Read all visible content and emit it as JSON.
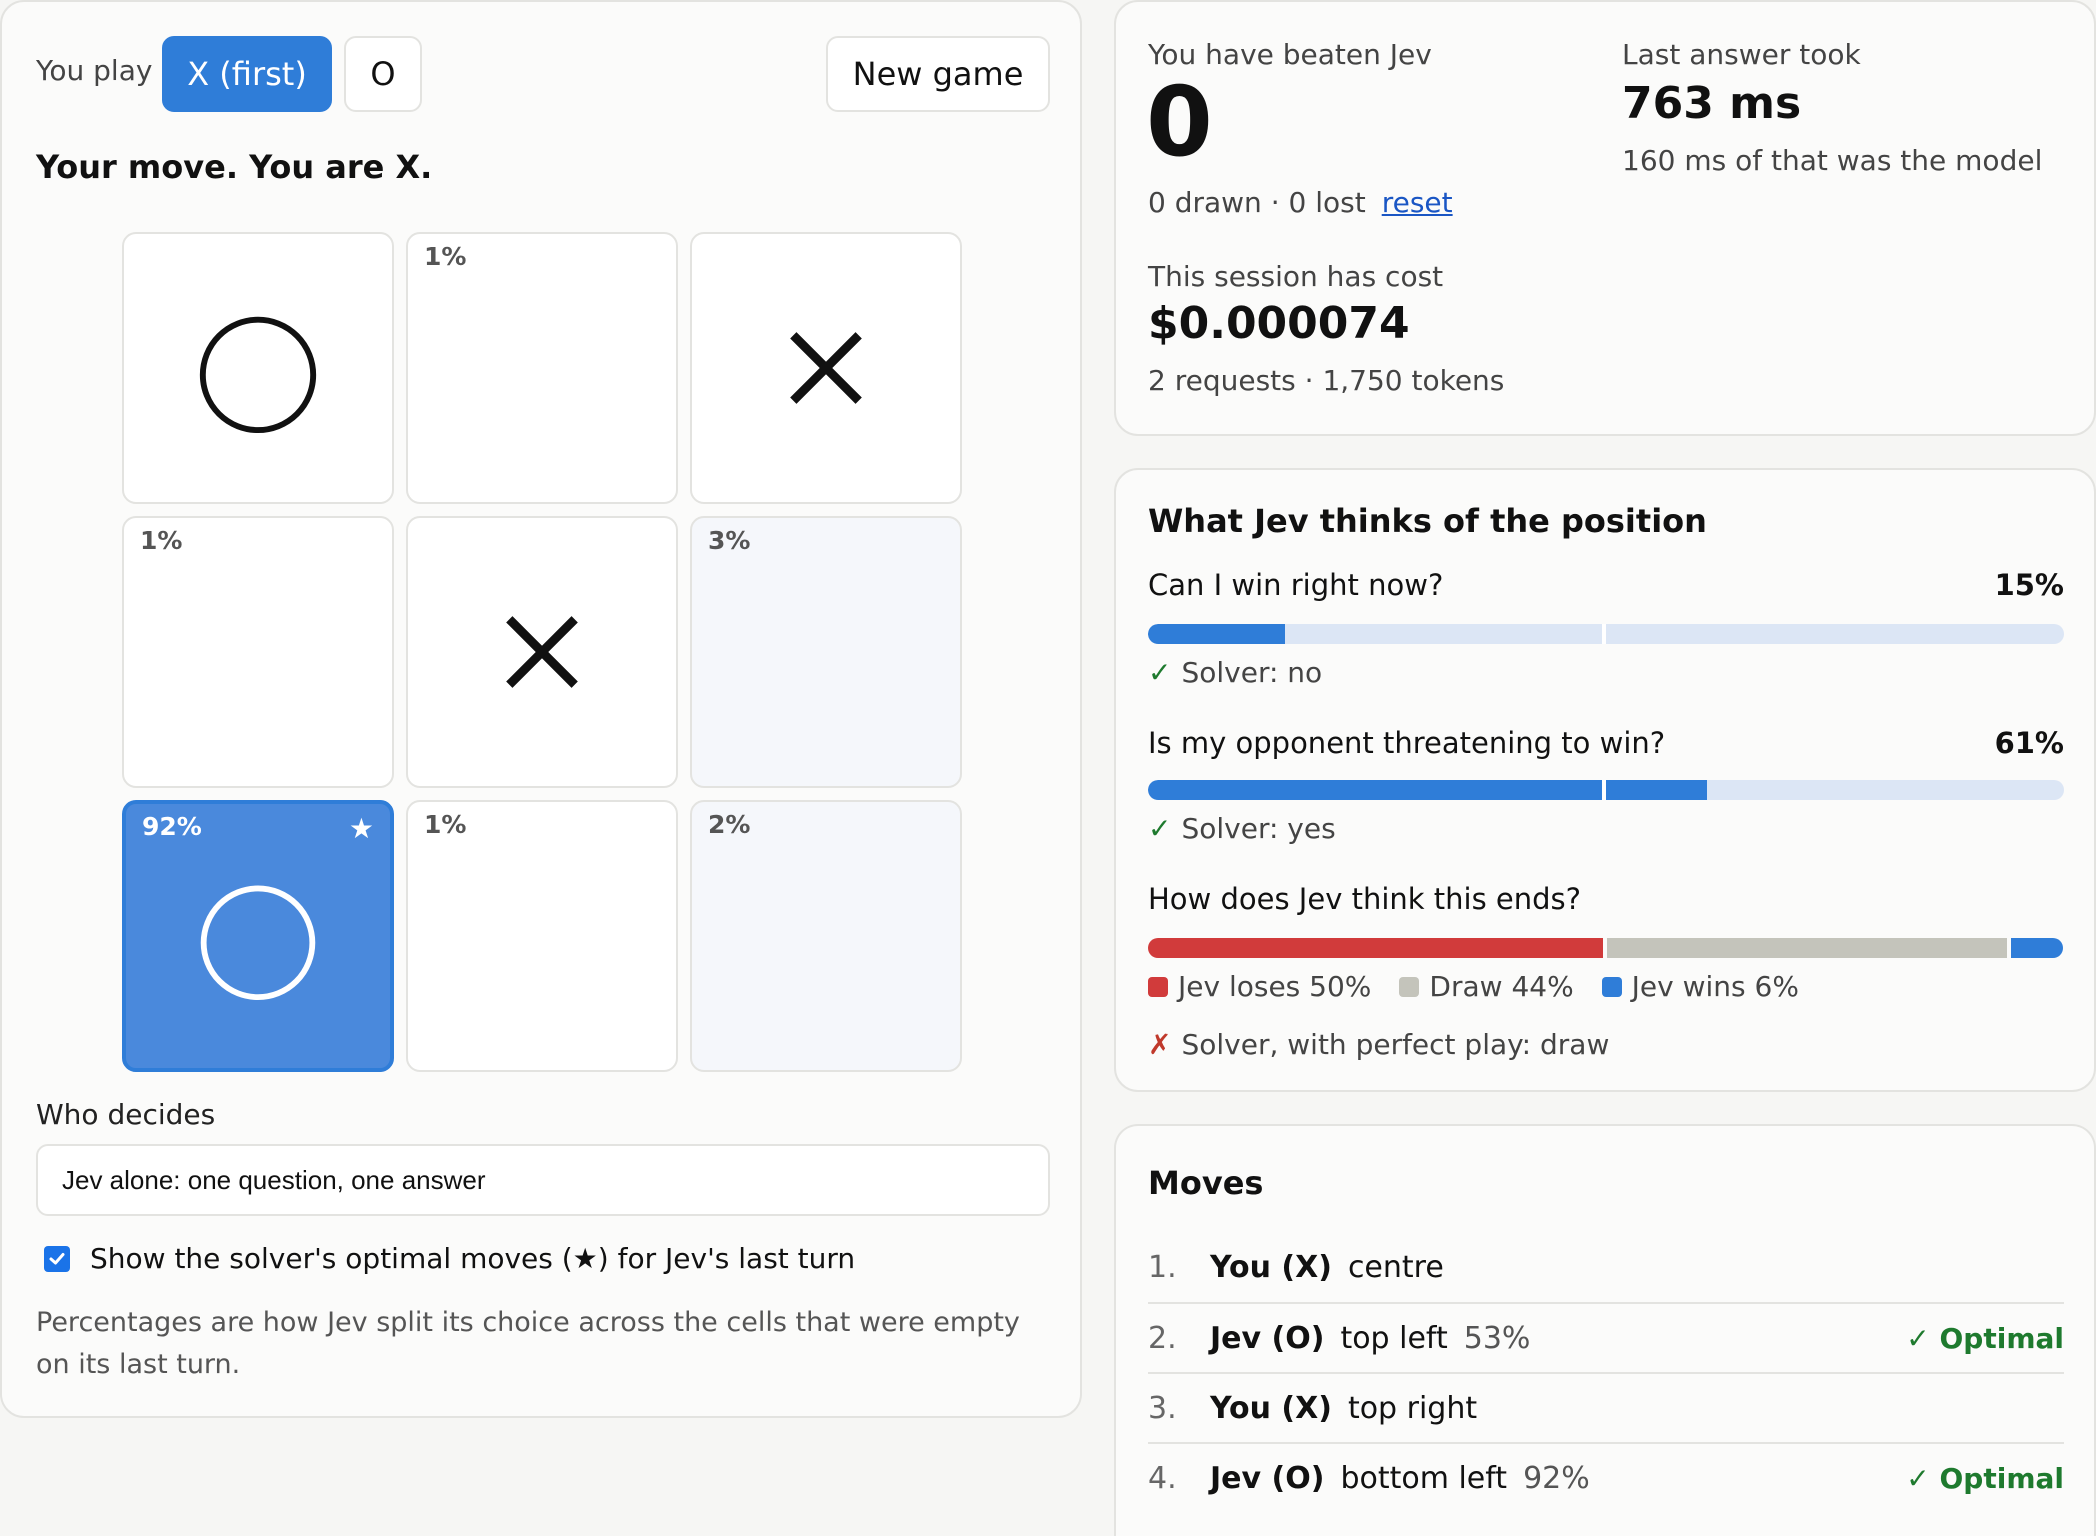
{
  "controls": {
    "you_play_label": "You play",
    "x_label": "X (first)",
    "o_label": "O",
    "new_game_label": "New game"
  },
  "status": "Your move. You are X.",
  "board": [
    {
      "mark": "O",
      "pct": ""
    },
    {
      "mark": "",
      "pct": "1%"
    },
    {
      "mark": "X",
      "pct": ""
    },
    {
      "mark": "",
      "pct": "1%"
    },
    {
      "mark": "X",
      "pct": ""
    },
    {
      "mark": "",
      "pct": "3%"
    },
    {
      "mark": "O",
      "pct": "92%",
      "star": "★",
      "highlight": true
    },
    {
      "mark": "",
      "pct": "1%"
    },
    {
      "mark": "",
      "pct": "2%"
    }
  ],
  "decider": {
    "label": "Who decides",
    "selected": "Jev alone: one question, one answer"
  },
  "show_optimal": {
    "checked": true,
    "label": "Show the solver's optimal moves (★) for Jev's last turn"
  },
  "note": "Percentages are how Jev split its choice across the cells that were empty on its last turn.",
  "stats": {
    "beaten_label": "You have beaten Jev",
    "beaten_count": "0",
    "record": "0 drawn · 0 lost",
    "reset_label": "reset",
    "last_label": "Last answer took",
    "last_value": "763 ms",
    "last_sub": "160 ms of that was the model",
    "cost_label": "This session has cost",
    "cost_value": "$0.000074",
    "cost_sub": "2 requests · 1,750 tokens"
  },
  "position": {
    "title": "What Jev thinks of the position",
    "q1": {
      "text": "Can I win right now?",
      "pct_label": "15%",
      "value": 0.15,
      "solver": "Solver: no",
      "solver_ok": true
    },
    "q2": {
      "text": "Is my opponent threatening to win?",
      "pct_label": "61%",
      "value": 0.61,
      "solver": "Solver: yes",
      "solver_ok": true
    },
    "ends": {
      "text": "How does Jev think this ends?",
      "loses": 0.5,
      "draw": 0.44,
      "wins": 0.06,
      "loses_label": "Jev loses 50%",
      "draw_label": "Draw 44%",
      "wins_label": "Jev wins 6%",
      "solver": "Solver, with perfect play: draw",
      "solver_ok": false
    },
    "colors": {
      "loses": "#d13b3b",
      "draw": "#c4c4bb",
      "wins": "#2f7dd8",
      "bar": "#2f7dd8"
    }
  },
  "moves": {
    "title": "Moves",
    "items": [
      {
        "num": "1.",
        "who": "You (X)",
        "where": "centre",
        "pct": "",
        "badge": ""
      },
      {
        "num": "2.",
        "who": "Jev (O)",
        "where": "top left",
        "pct": "53%",
        "badge": "✓ Optimal"
      },
      {
        "num": "3.",
        "who": "You (X)",
        "where": "top right",
        "pct": "",
        "badge": ""
      },
      {
        "num": "4.",
        "who": "Jev (O)",
        "where": "bottom left",
        "pct": "92%",
        "badge": "✓ Optimal"
      }
    ]
  }
}
